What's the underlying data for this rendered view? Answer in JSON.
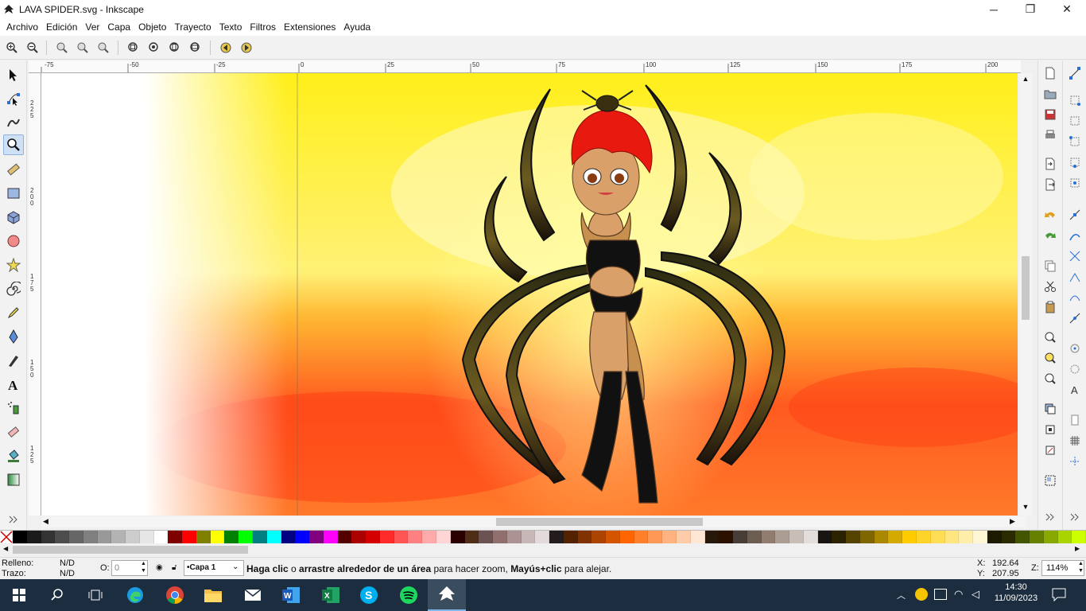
{
  "window": {
    "title": "LAVA SPIDER.svg - Inkscape",
    "buttons": {
      "minimize": "─",
      "maximize": "❐",
      "close": "✕"
    }
  },
  "menu": [
    "Archivo",
    "Edición",
    "Ver",
    "Capa",
    "Objeto",
    "Trayecto",
    "Texto",
    "Filtros",
    "Extensiones",
    "Ayuda"
  ],
  "ruler": {
    "h_labels": [
      "-75",
      "-50",
      "-25",
      "0",
      "25",
      "50",
      "75",
      "100",
      "125",
      "150",
      "175",
      "200"
    ],
    "v_labels": [
      "225",
      "200",
      "175",
      "150",
      "125"
    ]
  },
  "status": {
    "fill_label": "Relleno:",
    "fill_value": "N/D",
    "stroke_label": "Trazo:",
    "stroke_value": "N/D",
    "opacity_label": "O:",
    "opacity_value": "0",
    "layer": "•Capa 1",
    "message_parts": [
      "Haga clic",
      " o ",
      "arrastre alrededor de un área",
      " para hacer zoom, ",
      "Mayús+clic",
      " para alejar."
    ],
    "x_label": "X:",
    "x_value": "192.64",
    "y_label": "Y:",
    "y_value": "207.95",
    "zoom_label": "Z:",
    "zoom_value": "114%"
  },
  "taskbar": {
    "time": "14:30",
    "date": "11/09/2023"
  },
  "colors": {
    "palette": [
      "#000000",
      "#1a1a1a",
      "#333333",
      "#4d4d4d",
      "#666666",
      "#808080",
      "#999999",
      "#b3b3b3",
      "#cccccc",
      "#e6e6e6",
      "#ffffff",
      "#800000",
      "#ff0000",
      "#808000",
      "#ffff00",
      "#008000",
      "#00ff00",
      "#008080",
      "#00ffff",
      "#000080",
      "#0000ff",
      "#800080",
      "#ff00ff",
      "#550000",
      "#aa0000",
      "#d40000",
      "#ff2a2a",
      "#ff5555",
      "#ff8080",
      "#ffaaaa",
      "#ffd5d5",
      "#2b0000",
      "#502d16",
      "#6c5353",
      "#916f6f",
      "#ac9393",
      "#c8b7b7",
      "#e3dbdb",
      "#241c1c",
      "#552200",
      "#803300",
      "#aa4400",
      "#d45500",
      "#ff6600",
      "#ff7f2a",
      "#ff9955",
      "#ffb380",
      "#ffccaa",
      "#ffe6d5",
      "#28170b",
      "#2b1100",
      "#483e37",
      "#6c5d53",
      "#917c6f",
      "#ac9d93",
      "#c8beb7",
      "#e3dedb",
      "#171412",
      "#2b2200",
      "#554400",
      "#806600",
      "#aa8800",
      "#d4aa00",
      "#ffcc00",
      "#ffd42a",
      "#ffdd55",
      "#ffe680",
      "#ffeeaa",
      "#fff6d5",
      "#1c1a00",
      "#2b2b00",
      "#445500",
      "#668000",
      "#88aa00",
      "#aad400",
      "#ccff00"
    ],
    "accent": "#8fb3e0"
  }
}
